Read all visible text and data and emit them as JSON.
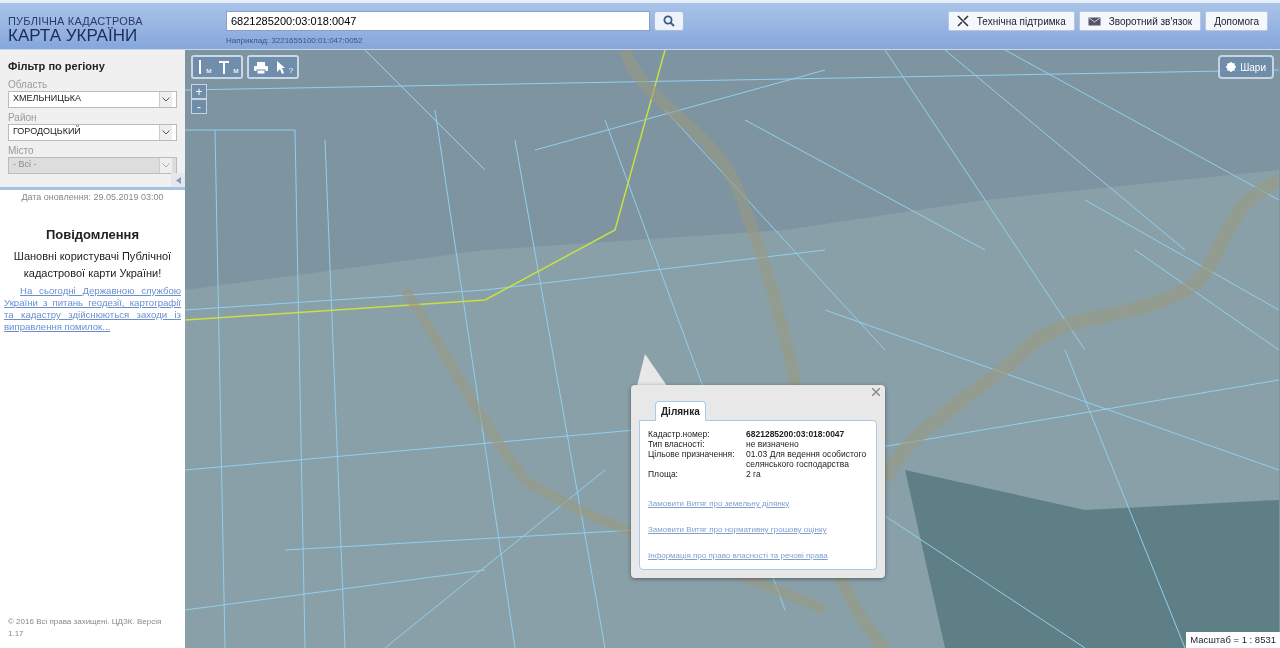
{
  "header": {
    "logo_line1": "ПУБЛІЧНА КАДАСТРОВА",
    "logo_line2": "КАРТА УКРАЇНИ",
    "search": {
      "value": "6821285200:03:018:0047",
      "hint": "Наприклад: 3221655100:01:047:0052"
    },
    "buttons": [
      {
        "label": "Технічна підтримка"
      },
      {
        "label": "Зворотний зв'язок"
      },
      {
        "label": "Допомога"
      }
    ]
  },
  "sidebar": {
    "filter": {
      "title": "Фільтр по регіону",
      "fields": [
        {
          "label": "Область",
          "value": "ХМЕЛЬНИЦЬКА",
          "disabled": false
        },
        {
          "label": "Район",
          "value": "ГОРОДОЦЬКИЙ",
          "disabled": false
        },
        {
          "label": "Місто",
          "value": "- Всі -",
          "disabled": true
        }
      ]
    },
    "update_date": "Дата оновлення: 29.05.2019 03:00",
    "notice": {
      "title": "Повідомлення",
      "greeting": "Шановні користувачі Публічної кадастрової карти України!",
      "link": "На сьогодні Державною службою України з питань геодезії, картографії та кадастру здійснюються заходи із виправлення помилок..."
    },
    "copyright": "© 2016 Всі права захищені. ЦДЗК. Версія 1.17"
  },
  "map": {
    "tools": [
      {
        "kind": "line",
        "sub": "м"
      },
      {
        "kind": "area",
        "sub": "м"
      },
      {
        "kind": "print"
      },
      {
        "kind": "identify",
        "sub": "?"
      }
    ],
    "zoom": [
      "+",
      "-"
    ],
    "layers_button": "Шари",
    "popup": {
      "tab": "Ділянка",
      "rows": [
        {
          "label": "Кадастр.номер:",
          "value": "6821285200:03:018:0047"
        },
        {
          "label": "Тип власності:",
          "value": "не визначено"
        },
        {
          "label": "Цільове призначення:",
          "value": "01.03 Для ведення особистого селянського господарства"
        },
        {
          "label": "Площа:",
          "value": "2 га"
        }
      ],
      "links": [
        "Замовити Витяг про земельну ділянку",
        "Замовити Витяг про нормативну грошову оцінку",
        "Інформація про право власності та речові права"
      ]
    },
    "scale": "Масштаб = 1 : 8531"
  }
}
